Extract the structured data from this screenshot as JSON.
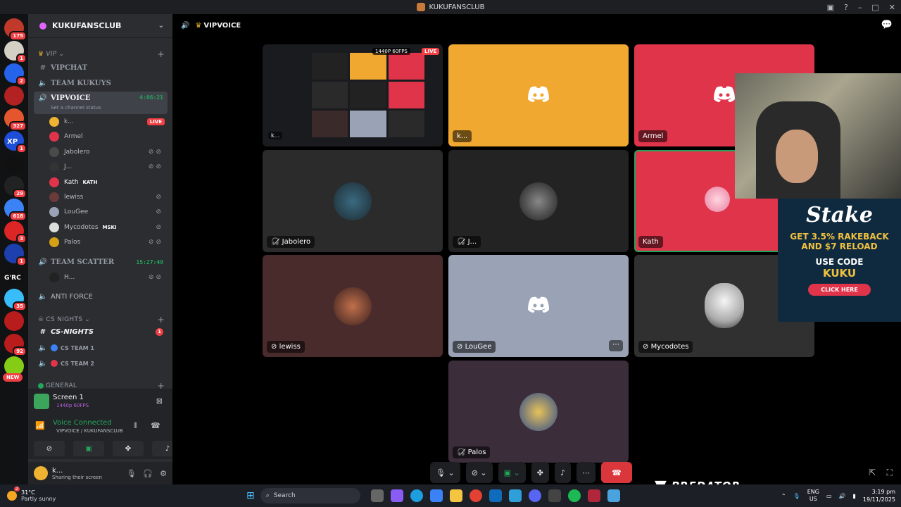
{
  "window": {
    "title": "KUKUFANSCLUB"
  },
  "rail": {
    "servers": [
      {
        "badge": "175",
        "color": "#c0392b"
      },
      {
        "badge": "1",
        "color": "#d5d0c4"
      },
      {
        "badge": "2",
        "color": "#2563eb"
      },
      {
        "badge": "",
        "color": "#b22222"
      },
      {
        "badge": "327",
        "color": "#e4572e"
      },
      {
        "badge": "1",
        "color": "#1d4ed8"
      },
      {
        "badge": "",
        "color": "#111"
      },
      {
        "badge": "29",
        "color": "#222"
      },
      {
        "badge": "618",
        "color": "#3b82f6"
      },
      {
        "badge": "3",
        "color": "#dc2626"
      },
      {
        "badge": "1",
        "color": "#1e40af"
      },
      {
        "badge": "",
        "color": "#111"
      },
      {
        "badge": "35",
        "color": "#38bdf8"
      },
      {
        "badge": "",
        "color": "#b91c1c"
      },
      {
        "badge": "92",
        "color": "#b91c1c"
      },
      {
        "badge": "",
        "color": "#84cc16"
      }
    ],
    "grc_label": "G'RC",
    "xp_label": "XP",
    "new_label": "NEW"
  },
  "server": {
    "name": "KUKUFANSCLUB"
  },
  "categories": {
    "vip": "VIP",
    "cs_nights": "CS NIGHTS",
    "general": "GENERAL"
  },
  "channels": {
    "vipchat": "VIPCHAT",
    "team_kukuys": "TEAM KUKUYS",
    "vipvoice": "VIPVOICE",
    "vipvoice_time": "4:06:21",
    "vipvoice_status": "Set a channel status",
    "team_scatter": "TEAM SCATTER",
    "team_scatter_time": "15:27:49",
    "anti_force": "ANTI FORCE",
    "cs_nights_text": "CS-NIGHTS",
    "cs_nights_unread": "1",
    "cs_team1": "CS TEAM 1",
    "cs_team2": "CS TEAM 2"
  },
  "voice_users": [
    {
      "name": "k...",
      "live": "LIVE",
      "color": "#f0b232"
    },
    {
      "name": "Armel",
      "color": "#e0344b"
    },
    {
      "name": "Jabolero",
      "color": "#4a4a4a"
    },
    {
      "name": "J...",
      "color": "#333"
    },
    {
      "name": "Kath",
      "tag": "KATH",
      "color": "#e0344b"
    },
    {
      "name": "lewiss",
      "color": "#6b3a3a"
    },
    {
      "name": "LouGee",
      "color": "#9aa3b5"
    },
    {
      "name": "Mycodotes",
      "tag": "MSKI",
      "color": "#ddd"
    },
    {
      "name": "Palos",
      "color": "#d4a017"
    }
  ],
  "team_scatter_user": "H...",
  "screen_panel": {
    "title": "Screen 1",
    "quality": "1440p 60FPS"
  },
  "voice_panel": {
    "status": "Voice Connected",
    "location": "VIPVOICE / KUKUFANSCLUB"
  },
  "user_panel": {
    "name": "k...",
    "status": "Sharing their screen"
  },
  "stage": {
    "channel": "VIPVOICE",
    "stream_quality": "1440P 60FPS",
    "live": "LIVE",
    "tiles": [
      {
        "name": "k..."
      },
      {
        "name": "k..."
      },
      {
        "name": "Armel"
      },
      {
        "name": "Jabolero"
      },
      {
        "name": "J..."
      },
      {
        "name": "Kath"
      },
      {
        "name": "lewiss"
      },
      {
        "name": "LouGee"
      },
      {
        "name": "Mycodotes"
      },
      {
        "name": "Palos"
      }
    ]
  },
  "ad": {
    "brand": "Stake",
    "line1": "GET 3.5% RAKEBACK",
    "line2": "AND $7 RELOAD",
    "line3": "USE CODE",
    "code": "KUKU",
    "cta": "CLICK HERE"
  },
  "overlay": {
    "predator": "PREDATOR"
  },
  "taskbar": {
    "weather_temp": "31°C",
    "weather_desc": "Partly sunny",
    "weather_badge": "2",
    "search": "Search",
    "lang1": "ENG",
    "lang2": "US",
    "time": "3:19 pm",
    "date": "19/11/2025"
  }
}
